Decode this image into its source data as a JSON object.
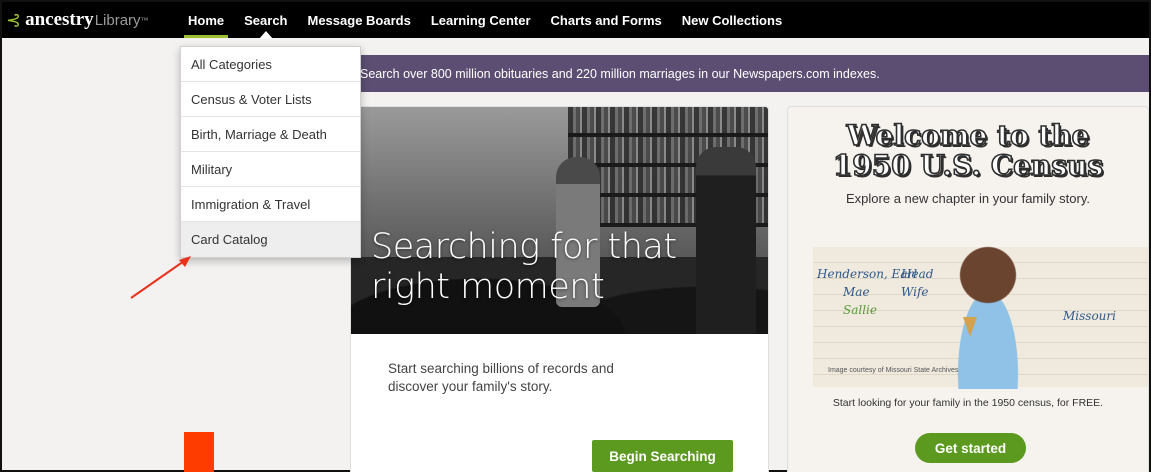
{
  "logo": {
    "name": "ancestry",
    "sub": "Library",
    "tm": "™"
  },
  "nav": {
    "items": [
      {
        "label": "Home"
      },
      {
        "label": "Search"
      },
      {
        "label": "Message Boards"
      },
      {
        "label": "Learning Center"
      },
      {
        "label": "Charts and Forms"
      },
      {
        "label": "New Collections"
      }
    ]
  },
  "banner": {
    "text": "Search over 800 million obituaries and 220 million marriages in our Newspapers.com indexes."
  },
  "dropdown": {
    "items": [
      {
        "label": "All Categories"
      },
      {
        "label": "Census & Voter Lists"
      },
      {
        "label": "Birth, Marriage & Death"
      },
      {
        "label": "Military"
      },
      {
        "label": "Immigration & Travel"
      },
      {
        "label": "Card Catalog"
      }
    ]
  },
  "card_left": {
    "headline_1": "Searching for that",
    "headline_2": "right moment",
    "body": "Start searching billions of records and discover your family's story.",
    "button": "Begin Searching"
  },
  "card_right": {
    "title_1": "Welcome to the",
    "title_2": "1950 U.S. Census",
    "subtitle": "Explore a new chapter in your family story.",
    "handwriting": [
      "Henderson, Earl",
      "Head",
      "Mae",
      "Wife",
      "Sallie",
      "Missouri"
    ],
    "credit": "Image courtesy of Missouri State Archives",
    "footer": "Start looking for your family in the 1950 census, for FREE.",
    "button": "Get started"
  },
  "annotation": {
    "arrow_color": "#e8321e",
    "marker_color": "#ff3c00"
  }
}
